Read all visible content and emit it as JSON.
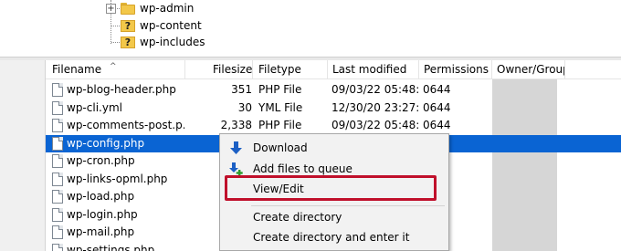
{
  "tree": {
    "items": [
      {
        "label": "wp-admin",
        "icon": "folder-icon",
        "expandable": true
      },
      {
        "label": "wp-content",
        "icon": "unknown-folder-icon",
        "expandable": false
      },
      {
        "label": "wp-includes",
        "icon": "unknown-folder-icon",
        "expandable": false
      }
    ]
  },
  "filelist": {
    "columns": [
      "Filename",
      "Filesize",
      "Filetype",
      "Last modified",
      "Permissions",
      "Owner/Group"
    ],
    "sort_indicator": "^",
    "rows": [
      {
        "name": "wp-blog-header.php",
        "size": "351",
        "type": "PHP File",
        "modified": "09/03/22 05:48:...",
        "perm": "0644",
        "selected": false
      },
      {
        "name": "wp-cli.yml",
        "size": "30",
        "type": "YML File",
        "modified": "12/30/20 23:27:...",
        "perm": "0644",
        "selected": false
      },
      {
        "name": "wp-comments-post.p...",
        "size": "2,338",
        "type": "PHP File",
        "modified": "09/03/22 05:48:...",
        "perm": "0644",
        "selected": false
      },
      {
        "name": "wp-config.php",
        "size": "",
        "type": "",
        "modified": "",
        "perm": "",
        "selected": true
      },
      {
        "name": "wp-cron.php",
        "size": "",
        "type": "",
        "modified": "",
        "perm": "",
        "selected": false
      },
      {
        "name": "wp-links-opml.php",
        "size": "",
        "type": "",
        "modified": "",
        "perm": "",
        "selected": false
      },
      {
        "name": "wp-load.php",
        "size": "",
        "type": "",
        "modified": "",
        "perm": "",
        "selected": false
      },
      {
        "name": "wp-login.php",
        "size": "",
        "type": "",
        "modified": "",
        "perm": "",
        "selected": false
      },
      {
        "name": "wp-mail.php",
        "size": "",
        "type": "",
        "modified": "",
        "perm": "",
        "selected": false
      },
      {
        "name": "wp-settings.php",
        "size": "",
        "type": "",
        "modified": "",
        "perm": "",
        "selected": false
      }
    ]
  },
  "context_menu": {
    "items": [
      {
        "label": "Download",
        "icon": "download-arrow-icon"
      },
      {
        "label": "Add files to queue",
        "icon": "add-to-queue-icon"
      },
      {
        "label": "View/Edit",
        "icon": ""
      },
      {
        "label": "Create directory",
        "icon": ""
      },
      {
        "label": "Create directory and enter it",
        "icon": ""
      }
    ],
    "highlight_color": "#c0102b"
  },
  "colors": {
    "selection": "#0a64d3",
    "owner_column_fill": "#d6d6d6",
    "menu_background": "#f2f2f2"
  }
}
